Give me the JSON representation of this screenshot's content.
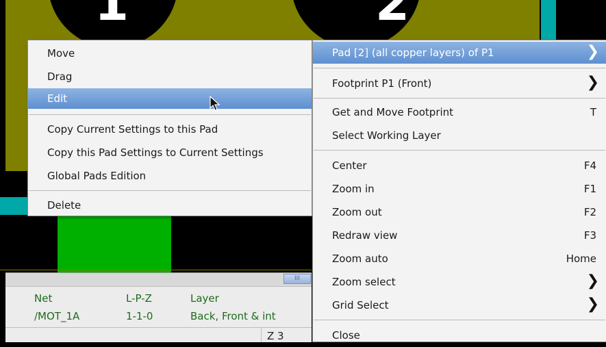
{
  "board": {
    "pad1_number": "1",
    "pad2_number": "2",
    "colors": {
      "background": "#000000",
      "olive": "#7f7f00",
      "green": "#00b000",
      "cyan": "#00a8a8"
    }
  },
  "context_menu": {
    "items": [
      {
        "label": "Move"
      },
      {
        "label": "Drag"
      },
      {
        "label": "Edit",
        "highlighted": true
      },
      {
        "label": "Copy Current Settings to this Pad"
      },
      {
        "label": "Copy this Pad Settings to Current Settings"
      },
      {
        "label": "Global Pads Edition"
      },
      {
        "label": "Delete"
      }
    ]
  },
  "main_menu": {
    "header": {
      "label": "Pad [2] (all copper layers) of P1",
      "arrow": "❯"
    },
    "items": [
      {
        "label": "Footprint P1 (Front)",
        "arrow": "❯"
      },
      {
        "label": "Get and Move Footprint",
        "shortcut": "T"
      },
      {
        "label": "Select Working Layer"
      },
      {
        "label": "Center",
        "shortcut": "F4"
      },
      {
        "label": "Zoom in",
        "shortcut": "F1"
      },
      {
        "label": "Zoom out",
        "shortcut": "F2"
      },
      {
        "label": "Redraw view",
        "shortcut": "F3"
      },
      {
        "label": "Zoom auto",
        "shortcut": "Home"
      },
      {
        "label": "Zoom select",
        "arrow": "❯"
      },
      {
        "label": "Grid Select",
        "arrow": "❯"
      },
      {
        "label": "Close"
      }
    ]
  },
  "status": {
    "headers": [
      "Net",
      "L-P-Z",
      "Layer"
    ],
    "values": [
      "/MOT_1A",
      "1-1-0",
      "Back, Front & int"
    ],
    "zoom": "Z 3",
    "scroll_thumb": "III"
  }
}
